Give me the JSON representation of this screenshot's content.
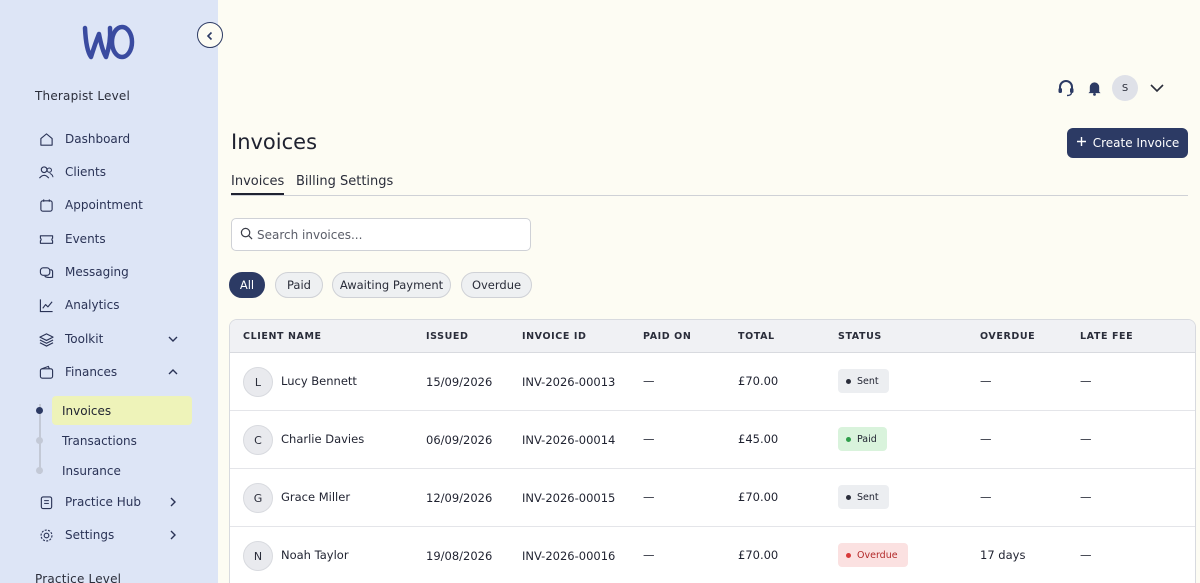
{
  "app": {
    "logo_text": "WO",
    "accent": "#2c3a64",
    "sidebar_bg": "#dde5f6"
  },
  "sidebar": {
    "level_label": "Therapist Level",
    "items": [
      {
        "label": "Dashboard",
        "icon": "home-icon"
      },
      {
        "label": "Clients",
        "icon": "users-icon"
      },
      {
        "label": "Appointment",
        "icon": "calendar-icon"
      },
      {
        "label": "Events",
        "icon": "ticket-icon"
      },
      {
        "label": "Messaging",
        "icon": "chat-icon"
      },
      {
        "label": "Analytics",
        "icon": "chart-icon"
      },
      {
        "label": "Toolkit",
        "icon": "layers-icon",
        "expander": "chevron-down-icon"
      },
      {
        "label": "Finances",
        "icon": "wallet-icon",
        "expander": "chevron-up-icon"
      },
      {
        "label": "Practice Hub",
        "icon": "building-icon",
        "expander": "chevron-right-icon"
      },
      {
        "label": "Settings",
        "icon": "gear-icon",
        "expander": "chevron-right-icon"
      }
    ],
    "finance_sub": [
      {
        "label": "Invoices",
        "active": true
      },
      {
        "label": "Transactions"
      },
      {
        "label": "Insurance"
      }
    ],
    "practice_label": "Practice Level"
  },
  "header": {
    "avatar_initial": "S"
  },
  "page": {
    "title": "Invoices",
    "create_button": "Create Invoice",
    "tabs": [
      "Invoices",
      "Billing Settings"
    ],
    "search_placeholder": "Search invoices...",
    "filters": [
      "All",
      "Paid",
      "Awaiting Payment",
      "Overdue"
    ],
    "active_filter": "All"
  },
  "table": {
    "columns": [
      "CLIENT NAME",
      "ISSUED",
      "INVOICE ID",
      "PAID ON",
      "TOTAL",
      "STATUS",
      "OVERDUE",
      "LATE FEE"
    ],
    "rows": [
      {
        "initial": "L",
        "name": "Lucy Bennett",
        "issued": "15/09/2026",
        "invoice_id": "INV-2026-00013",
        "paid_on": "—",
        "total": "£70.00",
        "status": "Sent",
        "overdue": "—",
        "late_fee": "—"
      },
      {
        "initial": "C",
        "name": "Charlie Davies",
        "issued": "06/09/2026",
        "invoice_id": "INV-2026-00014",
        "paid_on": "—",
        "total": "£45.00",
        "status": "Paid",
        "overdue": "—",
        "late_fee": "—"
      },
      {
        "initial": "G",
        "name": "Grace Miller",
        "issued": "12/09/2026",
        "invoice_id": "INV-2026-00015",
        "paid_on": "—",
        "total": "£70.00",
        "status": "Sent",
        "overdue": "—",
        "late_fee": "—"
      },
      {
        "initial": "N",
        "name": "Noah Taylor",
        "issued": "19/08/2026",
        "invoice_id": "INV-2026-00016",
        "paid_on": "—",
        "total": "£70.00",
        "status": "Overdue",
        "overdue": "17 days",
        "late_fee": "—"
      }
    ],
    "status_colors": {
      "Sent": {
        "bg": "#eceef1",
        "dot": "#2a2d3a"
      },
      "Paid": {
        "bg": "#d9f3dc",
        "dot": "#2e9e4a"
      },
      "Overdue": {
        "bg": "#fbe1e1",
        "dot": "#d83a3a"
      }
    }
  }
}
